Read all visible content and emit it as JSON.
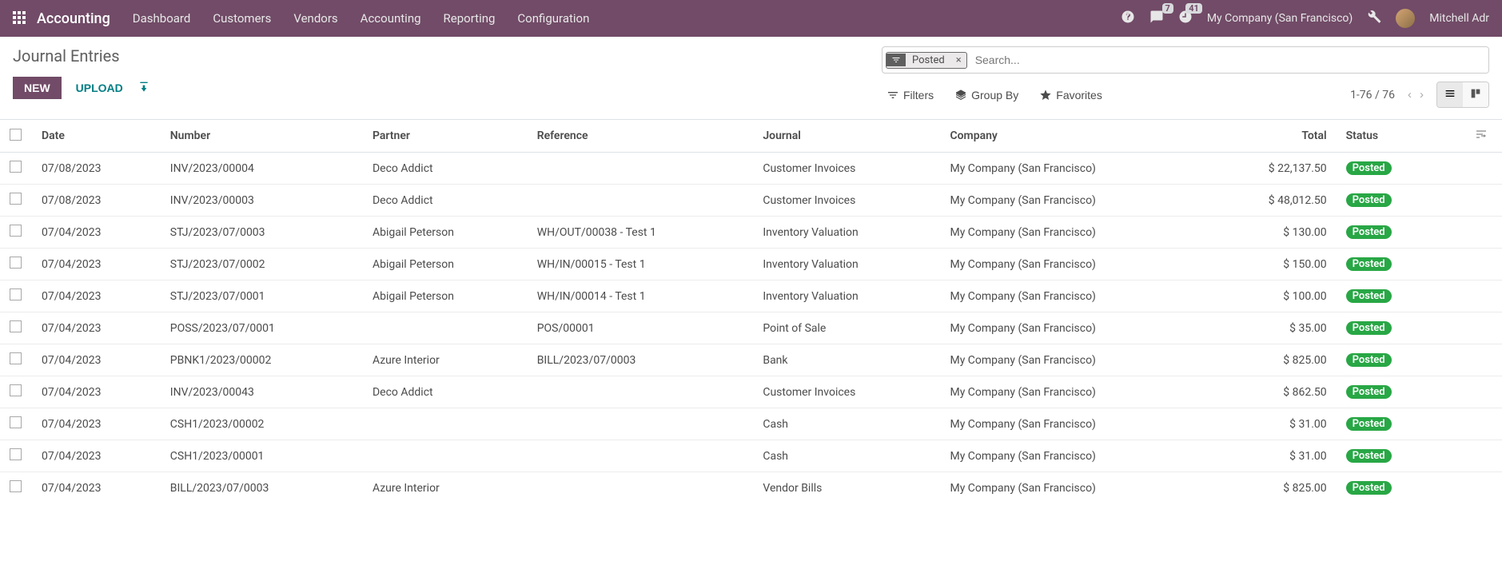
{
  "navbar": {
    "brand": "Accounting",
    "menu": [
      "Dashboard",
      "Customers",
      "Vendors",
      "Accounting",
      "Reporting",
      "Configuration"
    ],
    "messages_count": "7",
    "tasks_count": "41",
    "company": "My Company (San Francisco)",
    "user": "Mitchell Adr"
  },
  "page": {
    "title": "Journal Entries",
    "new_label": "NEW",
    "upload_label": "UPLOAD"
  },
  "search": {
    "chip_label": "Posted",
    "placeholder": "Search..."
  },
  "controls": {
    "filters": "Filters",
    "groupby": "Group By",
    "favorites": "Favorites",
    "pager": "1-76 / 76"
  },
  "columns": {
    "date": "Date",
    "number": "Number",
    "partner": "Partner",
    "reference": "Reference",
    "journal": "Journal",
    "company": "Company",
    "total": "Total",
    "status": "Status"
  },
  "rows": [
    {
      "date": "07/08/2023",
      "number": "INV/2023/00004",
      "partner": "Deco Addict",
      "reference": "",
      "journal": "Customer Invoices",
      "company": "My Company (San Francisco)",
      "total": "$ 22,137.50",
      "status": "Posted"
    },
    {
      "date": "07/08/2023",
      "number": "INV/2023/00003",
      "partner": "Deco Addict",
      "reference": "",
      "journal": "Customer Invoices",
      "company": "My Company (San Francisco)",
      "total": "$ 48,012.50",
      "status": "Posted"
    },
    {
      "date": "07/04/2023",
      "number": "STJ/2023/07/0003",
      "partner": "Abigail Peterson",
      "reference": "WH/OUT/00038 - Test 1",
      "journal": "Inventory Valuation",
      "company": "My Company (San Francisco)",
      "total": "$ 130.00",
      "status": "Posted"
    },
    {
      "date": "07/04/2023",
      "number": "STJ/2023/07/0002",
      "partner": "Abigail Peterson",
      "reference": "WH/IN/00015 - Test 1",
      "journal": "Inventory Valuation",
      "company": "My Company (San Francisco)",
      "total": "$ 150.00",
      "status": "Posted"
    },
    {
      "date": "07/04/2023",
      "number": "STJ/2023/07/0001",
      "partner": "Abigail Peterson",
      "reference": "WH/IN/00014 - Test 1",
      "journal": "Inventory Valuation",
      "company": "My Company (San Francisco)",
      "total": "$ 100.00",
      "status": "Posted"
    },
    {
      "date": "07/04/2023",
      "number": "POSS/2023/07/0001",
      "partner": "",
      "reference": "POS/00001",
      "journal": "Point of Sale",
      "company": "My Company (San Francisco)",
      "total": "$ 35.00",
      "status": "Posted"
    },
    {
      "date": "07/04/2023",
      "number": "PBNK1/2023/00002",
      "partner": "Azure Interior",
      "reference": "BILL/2023/07/0003",
      "journal": "Bank",
      "company": "My Company (San Francisco)",
      "total": "$ 825.00",
      "status": "Posted"
    },
    {
      "date": "07/04/2023",
      "number": "INV/2023/00043",
      "partner": "Deco Addict",
      "reference": "",
      "journal": "Customer Invoices",
      "company": "My Company (San Francisco)",
      "total": "$ 862.50",
      "status": "Posted"
    },
    {
      "date": "07/04/2023",
      "number": "CSH1/2023/00002",
      "partner": "",
      "reference": "",
      "journal": "Cash",
      "company": "My Company (San Francisco)",
      "total": "$ 31.00",
      "status": "Posted"
    },
    {
      "date": "07/04/2023",
      "number": "CSH1/2023/00001",
      "partner": "",
      "reference": "",
      "journal": "Cash",
      "company": "My Company (San Francisco)",
      "total": "$ 31.00",
      "status": "Posted"
    },
    {
      "date": "07/04/2023",
      "number": "BILL/2023/07/0003",
      "partner": "Azure Interior",
      "reference": "",
      "journal": "Vendor Bills",
      "company": "My Company (San Francisco)",
      "total": "$ 825.00",
      "status": "Posted"
    }
  ]
}
